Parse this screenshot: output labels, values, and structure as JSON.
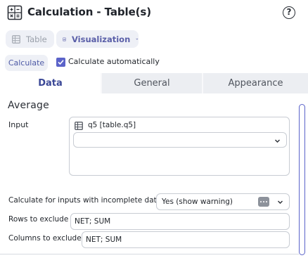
{
  "header": {
    "title": "Calculation - Table(s)",
    "help_symbol": "?",
    "app_icon": "calculator-icon",
    "help_icon": "help-circle-icon"
  },
  "toolbar": {
    "table_label": "Table",
    "table_icon": "table-icon",
    "visualization_label": "Visualization",
    "visualization_icon": "chart-icon",
    "visualization_chevron": "chevron-down-icon"
  },
  "calc": {
    "button_label": "Calculate",
    "auto_label": "Calculate automatically",
    "auto_checked": true
  },
  "tabs": [
    {
      "label": "Data",
      "active": true
    },
    {
      "label": "General",
      "active": false
    },
    {
      "label": "Appearance",
      "active": false
    }
  ],
  "section": {
    "title": "Average"
  },
  "input": {
    "label": "Input",
    "tag": "q5 [table.q5]",
    "tag_icon": "table-icon",
    "select_value": ""
  },
  "incomplete": {
    "label": "Calculate for inputs with incomplete data",
    "value": "Yes (show warning)",
    "more_icon": "more-dots-icon"
  },
  "rows_exclude": {
    "label": "Rows to exclude",
    "value": "NET; SUM"
  },
  "cols_exclude": {
    "label": "Columns to exclude",
    "value": "NET; SUM"
  },
  "colors": {
    "accent": "#5b63c9",
    "active_tab_text": "#3a4796",
    "tab_bar_bg": "#eceef2",
    "button_bg": "#eef0f6"
  }
}
